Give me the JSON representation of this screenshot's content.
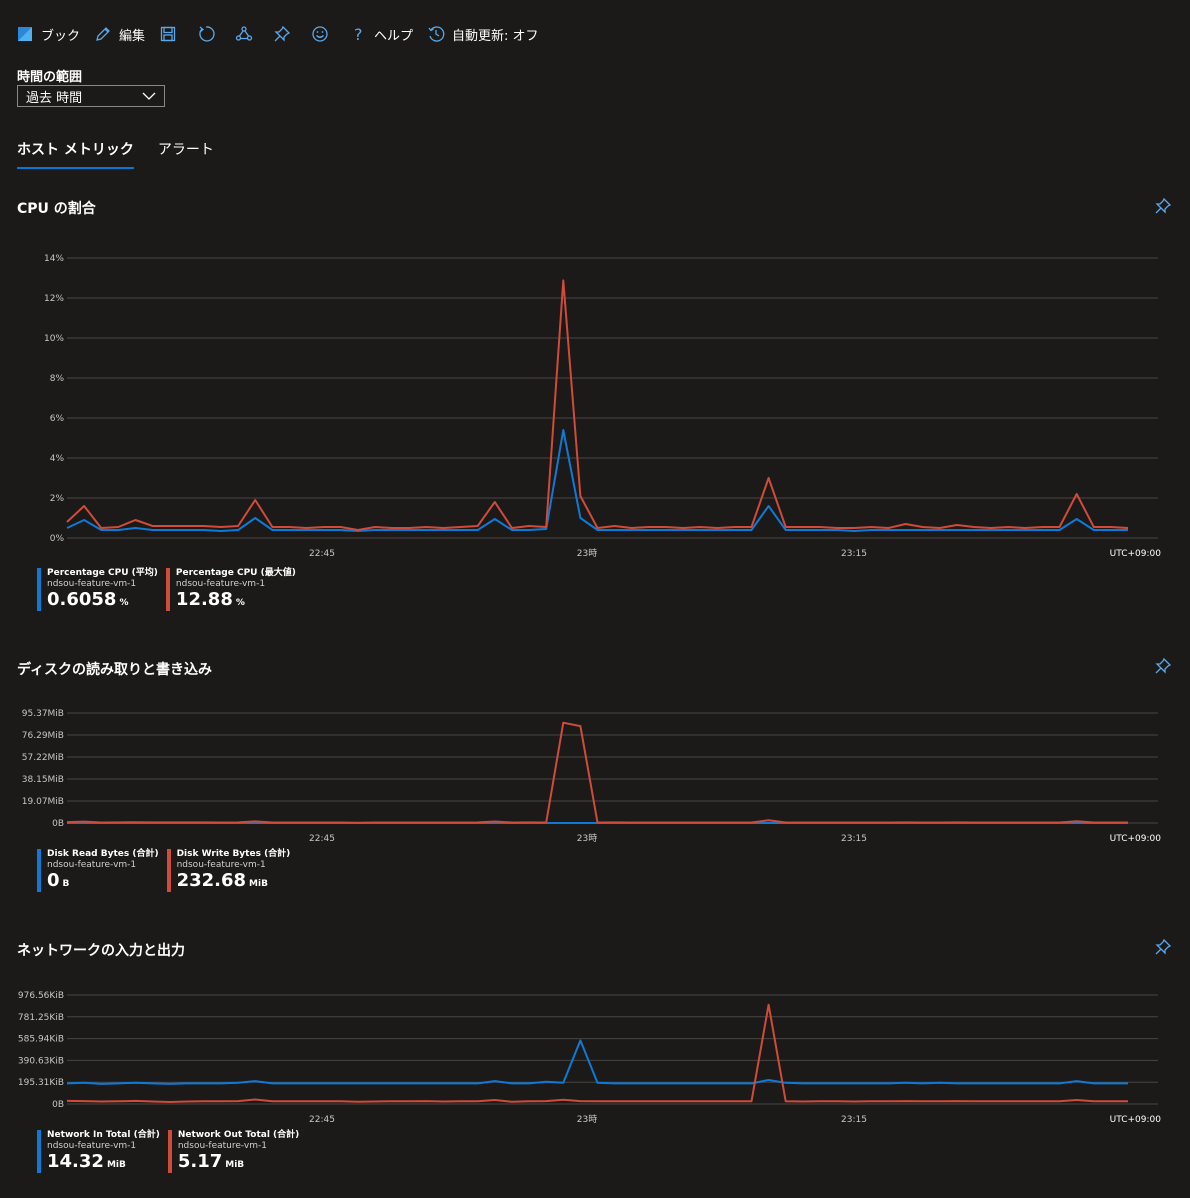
{
  "toolbar": {
    "workbook": "ブック",
    "edit": "編集",
    "help": "ヘルプ",
    "autorefresh": "自動更新: オフ"
  },
  "time_range": {
    "label": "時間の範囲",
    "value": "過去 時間"
  },
  "tabs": [
    {
      "label": "ホスト メトリック",
      "active": true
    },
    {
      "label": "アラート",
      "active": false
    }
  ],
  "colors": {
    "blue": "#0e7ad6",
    "red": "#cf4b3a",
    "background": "#1b1a19",
    "grid": "#484644"
  },
  "chart_data": [
    {
      "type": "line",
      "title": "CPU の割合",
      "y_ticks": [
        "0%",
        "2%",
        "4%",
        "6%",
        "8%",
        "10%",
        "12%",
        "14%"
      ],
      "ylim": [
        0,
        14
      ],
      "x_ticks": [
        "22:45",
        "23時",
        "23:15"
      ],
      "timezone": "UTC+09:00",
      "series": [
        {
          "name": "Percentage CPU (平均)",
          "resource": "ndsou-feature-vm-1",
          "summary": "0.6058",
          "unit": "%",
          "color": "#0e7ad6",
          "values": [
            0.5,
            0.9,
            0.4,
            0.4,
            0.5,
            0.4,
            0.4,
            0.4,
            0.4,
            0.35,
            0.4,
            1.0,
            0.4,
            0.4,
            0.4,
            0.4,
            0.4,
            0.35,
            0.4,
            0.4,
            0.4,
            0.4,
            0.4,
            0.4,
            0.4,
            0.95,
            0.4,
            0.4,
            0.45,
            5.4,
            1.0,
            0.4,
            0.4,
            0.4,
            0.4,
            0.4,
            0.4,
            0.4,
            0.4,
            0.4,
            0.4,
            1.6,
            0.4,
            0.4,
            0.4,
            0.4,
            0.35,
            0.4,
            0.4,
            0.4,
            0.4,
            0.4,
            0.4,
            0.4,
            0.4,
            0.4,
            0.4,
            0.4,
            0.4,
            0.95,
            0.4,
            0.4,
            0.4
          ]
        },
        {
          "name": "Percentage CPU (最大値)",
          "resource": "ndsou-feature-vm-1",
          "summary": "12.88",
          "unit": "%",
          "color": "#cf4b3a",
          "values": [
            0.8,
            1.6,
            0.5,
            0.55,
            0.9,
            0.6,
            0.6,
            0.6,
            0.6,
            0.55,
            0.6,
            1.9,
            0.55,
            0.55,
            0.5,
            0.55,
            0.55,
            0.4,
            0.55,
            0.5,
            0.5,
            0.55,
            0.5,
            0.55,
            0.6,
            1.8,
            0.5,
            0.6,
            0.55,
            12.88,
            2.1,
            0.5,
            0.6,
            0.5,
            0.55,
            0.55,
            0.5,
            0.55,
            0.5,
            0.55,
            0.55,
            3.0,
            0.55,
            0.55,
            0.55,
            0.5,
            0.5,
            0.55,
            0.5,
            0.7,
            0.55,
            0.5,
            0.65,
            0.55,
            0.5,
            0.55,
            0.5,
            0.55,
            0.55,
            2.2,
            0.55,
            0.55,
            0.5
          ]
        }
      ]
    },
    {
      "type": "line",
      "title": "ディスクの読み取りと書き込み",
      "y_ticks": [
        "0B",
        "19.07MiB",
        "38.15MiB",
        "57.22MiB",
        "76.29MiB",
        "95.37MiB"
      ],
      "ylim": [
        0,
        95.37
      ],
      "x_ticks": [
        "22:45",
        "23時",
        "23:15"
      ],
      "timezone": "UTC+09:00",
      "series": [
        {
          "name": "Disk Read Bytes (合計)",
          "resource": "ndsou-feature-vm-1",
          "summary": "0",
          "unit": "B",
          "color": "#0e7ad6",
          "values": [
            0,
            0,
            0,
            0,
            0,
            0,
            0,
            0,
            0,
            0,
            0,
            0,
            0,
            0,
            0,
            0,
            0,
            0,
            0,
            0,
            0,
            0,
            0,
            0,
            0,
            0,
            0,
            0,
            0,
            0,
            0,
            0,
            0,
            0,
            0,
            0,
            0,
            0,
            0,
            0,
            0,
            0,
            0,
            0,
            0,
            0,
            0,
            0,
            0,
            0,
            0,
            0,
            0,
            0,
            0,
            0,
            0,
            0,
            0,
            0,
            0,
            0,
            0
          ]
        },
        {
          "name": "Disk Write Bytes (合計)",
          "resource": "ndsou-feature-vm-1",
          "summary": "232.68",
          "unit": "MiB",
          "color": "#cf4b3a",
          "values": [
            0.8,
            1.2,
            0.4,
            0.5,
            0.7,
            0.5,
            0.5,
            0.5,
            0.5,
            0.4,
            0.5,
            1.4,
            0.4,
            0.4,
            0.4,
            0.4,
            0.4,
            0.3,
            0.4,
            0.4,
            0.4,
            0.4,
            0.4,
            0.4,
            0.5,
            1.3,
            0.4,
            0.5,
            0.4,
            87.0,
            84.0,
            0.4,
            0.5,
            0.4,
            0.4,
            0.4,
            0.4,
            0.4,
            0.4,
            0.4,
            0.4,
            2.3,
            0.4,
            0.4,
            0.4,
            0.4,
            0.4,
            0.4,
            0.4,
            0.5,
            0.4,
            0.4,
            0.5,
            0.4,
            0.4,
            0.4,
            0.4,
            0.4,
            0.4,
            1.6,
            0.4,
            0.4,
            0.4
          ]
        }
      ]
    },
    {
      "type": "line",
      "title": "ネットワークの入力と出力",
      "y_ticks": [
        "0B",
        "195.31KiB",
        "390.63KiB",
        "585.94KiB",
        "781.25KiB",
        "976.56KiB"
      ],
      "ylim": [
        0,
        976.56
      ],
      "x_ticks": [
        "22:45",
        "23時",
        "23:15"
      ],
      "timezone": "UTC+09:00",
      "series": [
        {
          "name": "Network In Total (合計)",
          "resource": "ndsou-feature-vm-1",
          "summary": "14.32",
          "unit": "MiB",
          "color": "#0e7ad6",
          "values": [
            185,
            190,
            180,
            185,
            190,
            185,
            180,
            185,
            185,
            185,
            190,
            205,
            185,
            185,
            185,
            185,
            185,
            185,
            185,
            185,
            185,
            185,
            185,
            185,
            185,
            205,
            185,
            185,
            200,
            190,
            570,
            190,
            185,
            185,
            185,
            185,
            185,
            185,
            185,
            185,
            185,
            215,
            190,
            185,
            185,
            185,
            185,
            185,
            185,
            190,
            185,
            190,
            185,
            185,
            185,
            185,
            185,
            185,
            185,
            205,
            185,
            185,
            185
          ]
        },
        {
          "name": "Network Out Total (合計)",
          "resource": "ndsou-feature-vm-1",
          "summary": "5.17",
          "unit": "MiB",
          "color": "#cf4b3a",
          "values": [
            28,
            26,
            22,
            24,
            28,
            22,
            18,
            22,
            24,
            24,
            26,
            40,
            24,
            24,
            24,
            24,
            24,
            20,
            22,
            24,
            24,
            26,
            22,
            24,
            24,
            36,
            20,
            24,
            26,
            38,
            26,
            24,
            24,
            24,
            24,
            24,
            24,
            24,
            24,
            24,
            24,
            890,
            24,
            22,
            24,
            24,
            22,
            24,
            24,
            26,
            24,
            24,
            26,
            24,
            24,
            24,
            24,
            24,
            24,
            36,
            24,
            24,
            24
          ]
        }
      ]
    }
  ]
}
